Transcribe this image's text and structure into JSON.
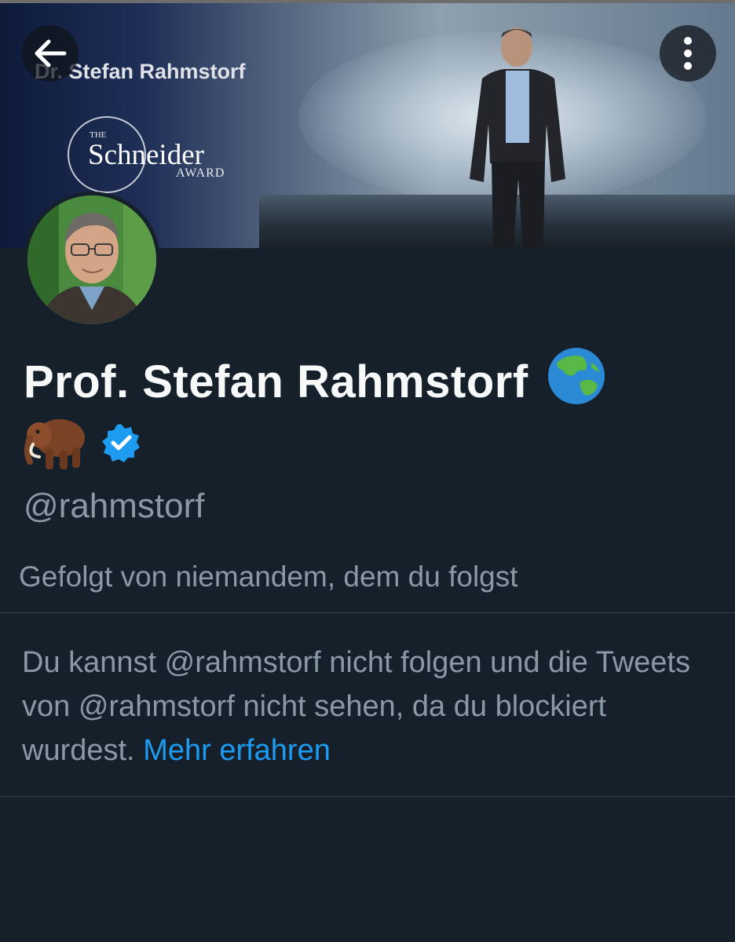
{
  "header": {
    "banner_title": "Dr. Stefan Rahmstorf",
    "award": {
      "small": "THE",
      "name": "Schneider",
      "sub": "AWARD"
    },
    "back_icon": "arrow-left-icon",
    "more_icon": "more-vertical-icon"
  },
  "profile": {
    "display_name": "Prof. Stefan Rahmstorf",
    "name_emojis": [
      "globe-asia-australia-icon",
      "mammoth-icon"
    ],
    "verified_icon": "verified-badge-icon",
    "handle": "@rahmstorf",
    "followed_by": "Gefolgt von niemandem, dem du folgst"
  },
  "blocked_notice": {
    "text": "Du kannst @rahmstorf nicht folgen und die Tweets von @rahmstorf nicht sehen, da du blockiert wurdest.",
    "link_text": "Mehr erfahren"
  },
  "colors": {
    "background": "#15202b",
    "primary_text": "#f7f9f9",
    "secondary_text": "#8b98a5",
    "link": "#1d9bf0",
    "verified": "#1d9bf0"
  }
}
